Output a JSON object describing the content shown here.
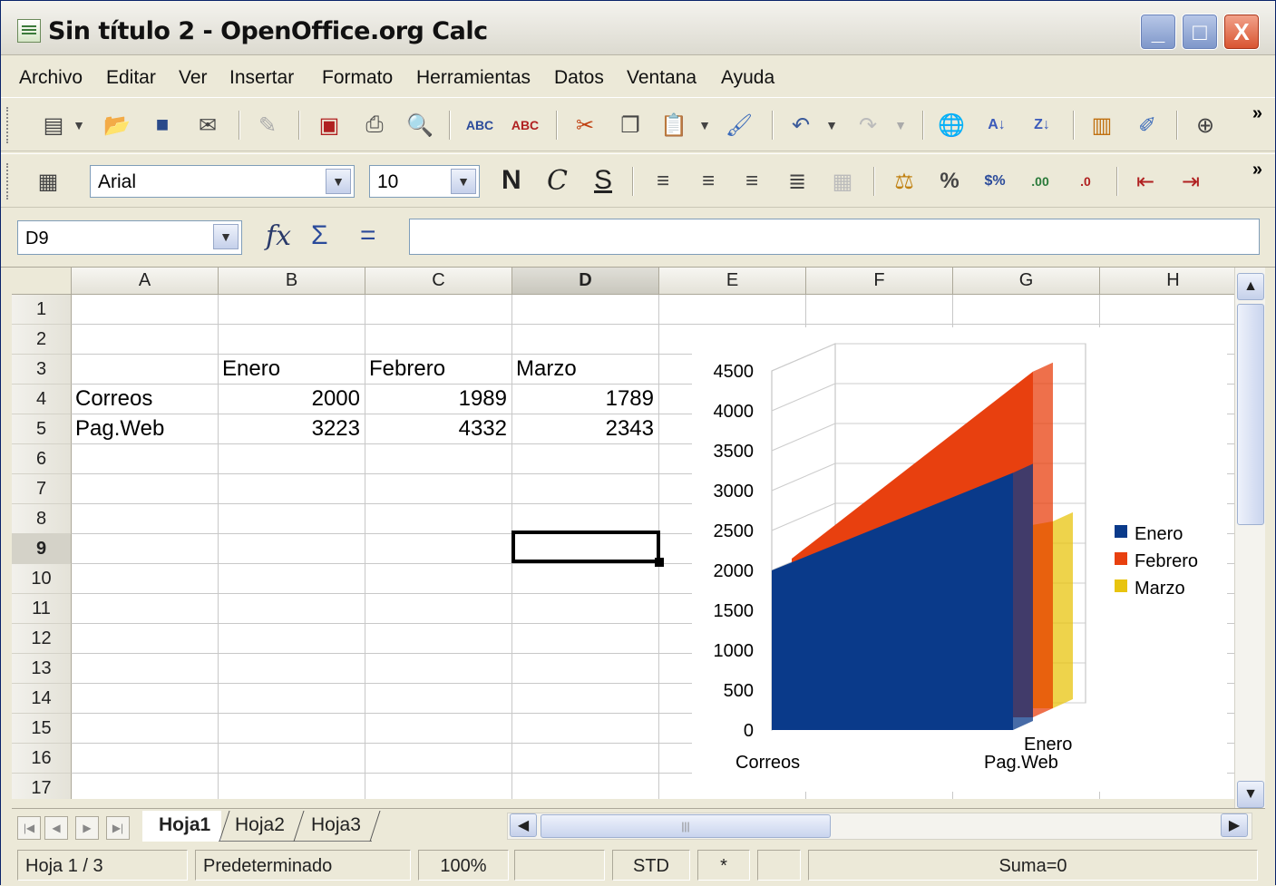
{
  "window": {
    "title": "Sin título 2 - OpenOffice.org Calc",
    "min": "_",
    "max": "□",
    "close": "X"
  },
  "menu": [
    "Archivo",
    "Editar",
    "Ver",
    "Insertar",
    "Formato",
    "Herramientas",
    "Datos",
    "Ventana",
    "Ayuda"
  ],
  "toolbar_format": {
    "font": "Arial",
    "size": "10",
    "bold": "N",
    "italic": "C",
    "underline": "S"
  },
  "formula_bar": {
    "cell_ref": "D9",
    "fx": "fx",
    "sum": "Σ",
    "equals": "=",
    "formula": ""
  },
  "columns": [
    "A",
    "B",
    "C",
    "D",
    "E",
    "F",
    "G",
    "H"
  ],
  "selected_column": "D",
  "rows": [
    "1",
    "2",
    "3",
    "4",
    "5",
    "6",
    "7",
    "8",
    "9",
    "10",
    "11",
    "12",
    "13",
    "14",
    "15",
    "16",
    "17"
  ],
  "selected_row": "9",
  "cells": {
    "B3": "Enero",
    "C3": "Febrero",
    "D3": "Marzo",
    "A4": "Correos",
    "B4": "2000",
    "C4": "1989",
    "D4": "1789",
    "A5": "Pag.Web",
    "B5": "3223",
    "C5": "4332",
    "D5": "2343"
  },
  "chart_data": {
    "type": "area",
    "categories": [
      "Correos",
      "Pag.Web"
    ],
    "series": [
      {
        "name": "Enero",
        "values": [
          2000,
          3223
        ],
        "color": "#0a3a8a"
      },
      {
        "name": "Febrero",
        "values": [
          1989,
          4332
        ],
        "color": "#e8400f"
      },
      {
        "name": "Marzo",
        "values": [
          1789,
          2343
        ],
        "color": "#e8c40f"
      }
    ],
    "y_ticks": [
      "0",
      "500",
      "1000",
      "1500",
      "2000",
      "2500",
      "3000",
      "3500",
      "4000",
      "4500"
    ],
    "ylim": [
      0,
      4500
    ],
    "depth_label": "Enero",
    "legend_position": "right"
  },
  "sheets": [
    "Hoja1",
    "Hoja2",
    "Hoja3"
  ],
  "active_sheet": "Hoja1",
  "status": {
    "sheet": "Hoja 1 / 3",
    "style": "Predeterminado",
    "zoom": "100%",
    "mode": "STD",
    "modified": "*",
    "sum": "Suma=0"
  }
}
